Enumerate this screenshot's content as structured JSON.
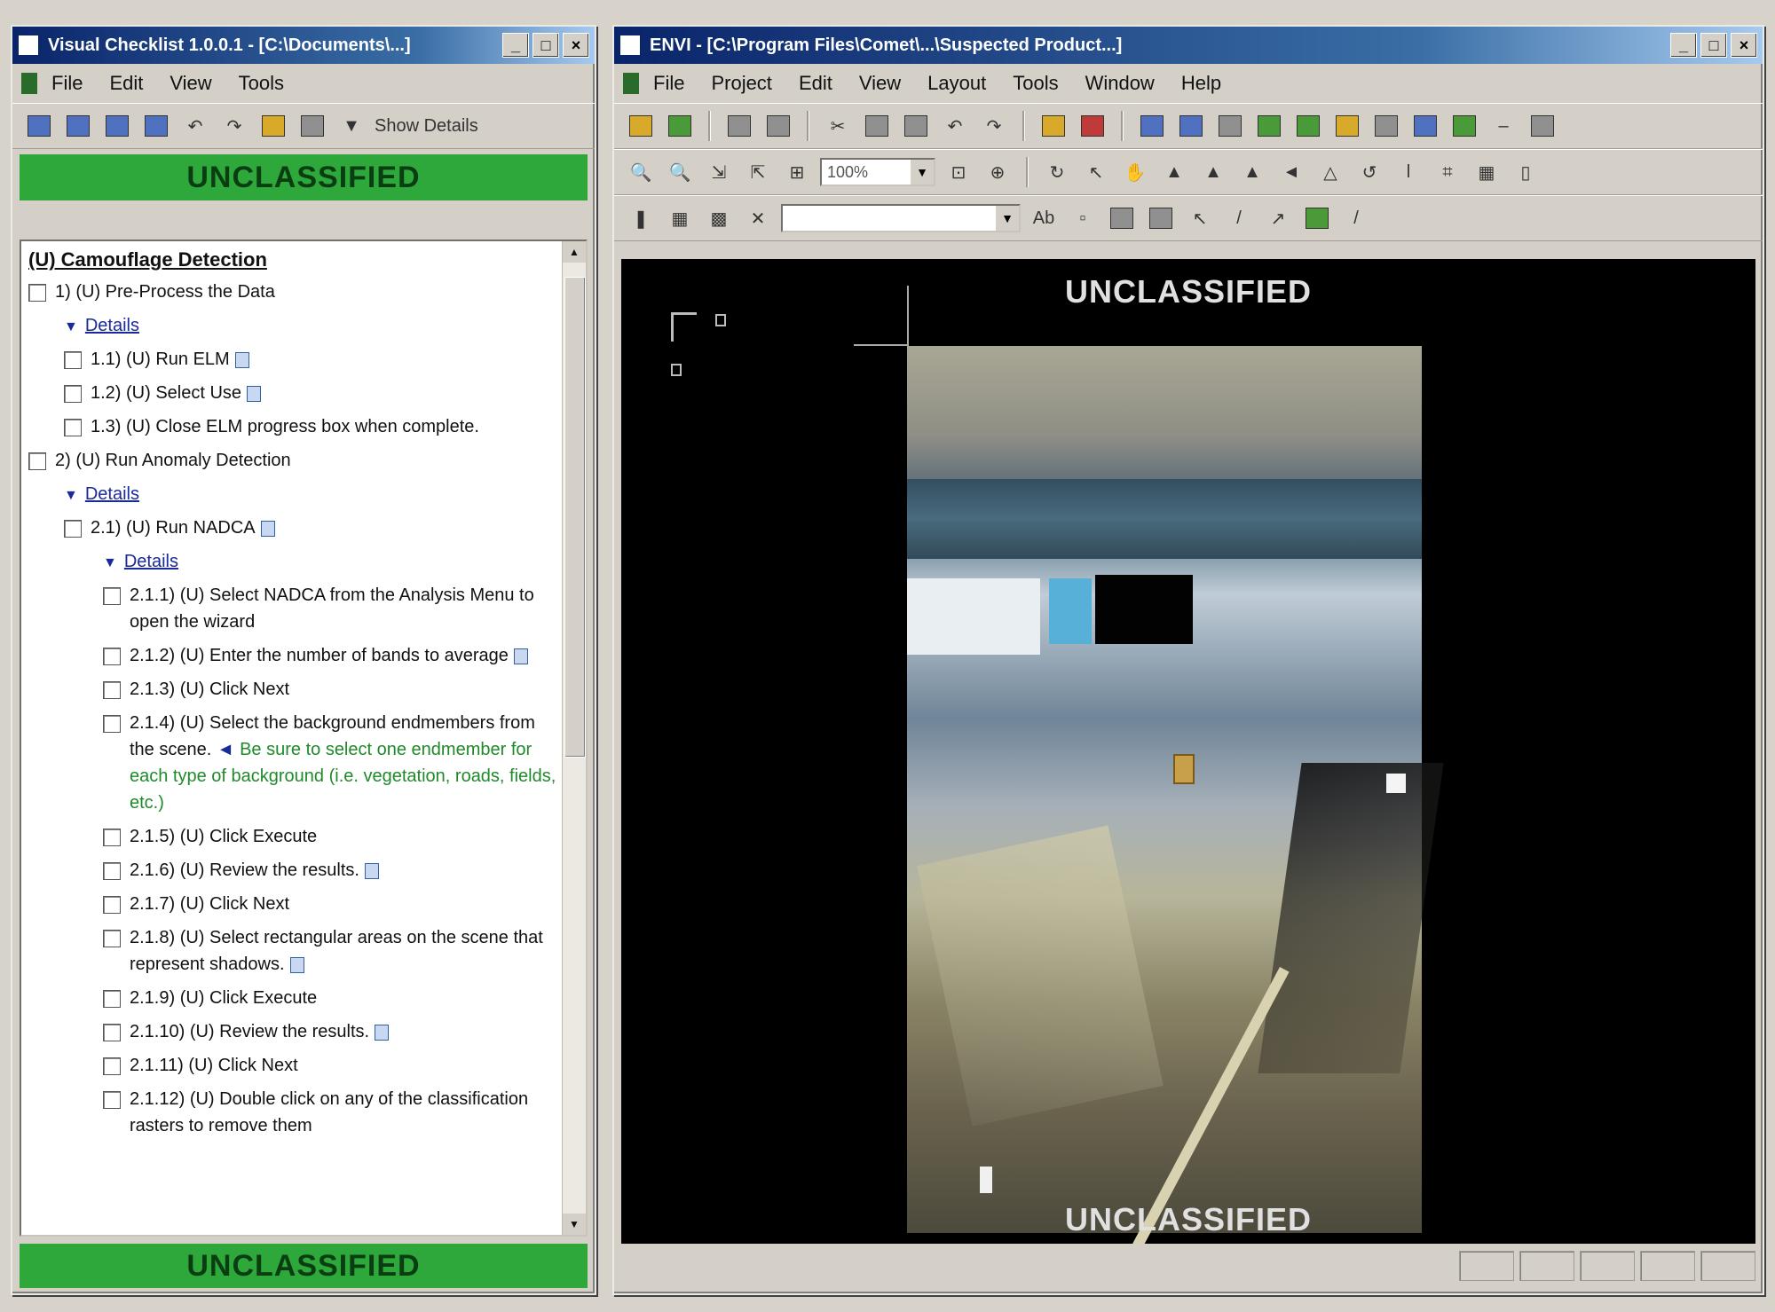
{
  "left_window": {
    "title": "Visual Checklist 1.0.0.1 - [C:\\Documents\\...]",
    "controls": [
      "_",
      "□",
      "×"
    ],
    "menu": [
      "File",
      "Edit",
      "View",
      "Tools"
    ],
    "toolbar": {
      "show_details_label": "Show Details"
    },
    "banner_top": "UNCLASSIFIED",
    "banner_bottom": "UNCLASSIFIED",
    "checklist": {
      "heading": "(U) Camouflage Detection",
      "items": [
        {
          "id": "s1",
          "text": "1) (U) Pre-Process the Data",
          "level": 0
        },
        {
          "id": "d1",
          "text": "Details",
          "type": "details",
          "level": 1
        },
        {
          "id": "s11",
          "text": "1.1) (U) Run ELM",
          "level": 1,
          "note": true
        },
        {
          "id": "s12",
          "text": "1.2) (U) Select Use",
          "level": 1,
          "note": true
        },
        {
          "id": "s13",
          "text": "1.3) (U) Close ELM progress box when complete.",
          "level": 1
        },
        {
          "id": "s2",
          "text": "2) (U) Run Anomaly Detection",
          "level": 0
        },
        {
          "id": "d2",
          "text": "Details",
          "type": "details",
          "level": 1
        },
        {
          "id": "s21",
          "text": "2.1) (U) Run NADCA",
          "level": 1,
          "note": true
        },
        {
          "id": "d3",
          "text": "Details",
          "type": "details",
          "level": 2
        },
        {
          "id": "s211",
          "text": "2.1.1) (U) Select NADCA from the Analysis Menu to open the wizard",
          "level": 2
        },
        {
          "id": "s212",
          "text": "2.1.2) (U) Enter the number of bands to average",
          "level": 2,
          "note": true
        },
        {
          "id": "s213",
          "text": "2.1.3) (U) Click Next",
          "level": 2
        },
        {
          "id": "s214",
          "text": "2.1.4) (U) Select the background endmembers from the scene.",
          "level": 2,
          "tip": "Be sure to select one endmember for each type of background (i.e. vegetation, roads, fields, etc.)"
        },
        {
          "id": "s215",
          "text": "2.1.5) (U) Click Execute",
          "level": 2
        },
        {
          "id": "s216",
          "text": "2.1.6) (U) Review the results.",
          "level": 2,
          "note": true
        },
        {
          "id": "s217",
          "text": "2.1.7) (U) Click Next",
          "level": 2
        },
        {
          "id": "s218",
          "text": "2.1.8) (U) Select rectangular areas on the scene that represent shadows.",
          "level": 2,
          "note": true
        },
        {
          "id": "s219",
          "text": "2.1.9) (U) Click Execute",
          "level": 2
        },
        {
          "id": "s2110",
          "text": "2.1.10) (U) Review the results.",
          "level": 2,
          "note": true
        },
        {
          "id": "s2111",
          "text": "2.1.11) (U) Click Next",
          "level": 2
        },
        {
          "id": "s2112",
          "text": "2.1.12) (U) Double click on any of the classification rasters to remove them",
          "level": 2
        }
      ]
    }
  },
  "right_window": {
    "title": "ENVI - [C:\\Program Files\\Comet\\...\\Suspected Product...]",
    "controls": [
      "_",
      "□",
      "×"
    ],
    "menu": [
      "File",
      "Project",
      "Edit",
      "View",
      "Layout",
      "Tools",
      "Window",
      "Help"
    ],
    "zoom_value": "100%",
    "viewer": {
      "banner_top": "UNCLASSIFIED",
      "banner_bottom": "UNCLASSIFIED"
    }
  }
}
